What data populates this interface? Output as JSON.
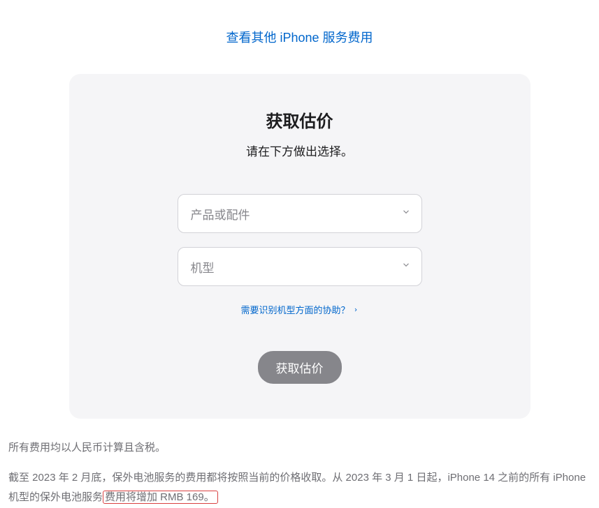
{
  "topLink": {
    "label": "查看其他 iPhone 服务费用"
  },
  "card": {
    "title": "获取估价",
    "subtitle": "请在下方做出选择。",
    "selectProduct": {
      "placeholder": "产品或配件"
    },
    "selectModel": {
      "placeholder": "机型"
    },
    "helpLink": {
      "label": "需要识别机型方面的协助？"
    },
    "button": {
      "label": "获取估价"
    }
  },
  "footer": {
    "line1": "所有费用均以人民币计算且含税。",
    "line2_part1": "截至 2023 年 2 月底，保外电池服务的费用都将按照当前的价格收取。从 2023 年 3 月 1 日起，iPhone 14 之前的所有 iPhone 机型的保外电池服务",
    "line2_highlighted": "费用将增加 RMB 169。"
  }
}
